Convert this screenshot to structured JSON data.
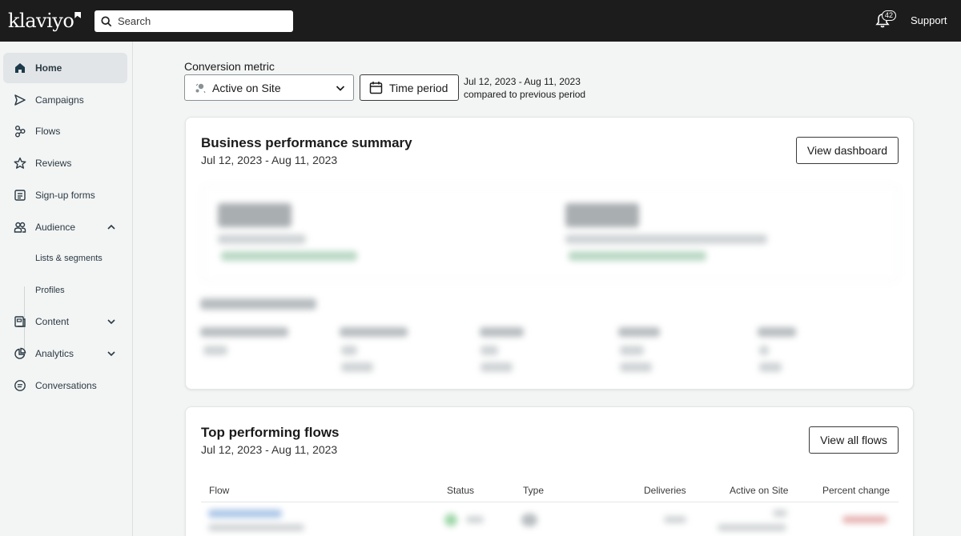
{
  "topbar": {
    "logo": "klaviyo",
    "search_placeholder": "Search",
    "notification_count": "42",
    "support_label": "Support"
  },
  "sidebar": {
    "items": [
      {
        "label": "Home",
        "icon": "home-icon",
        "active": true
      },
      {
        "label": "Campaigns",
        "icon": "send-icon"
      },
      {
        "label": "Flows",
        "icon": "flows-icon"
      },
      {
        "label": "Reviews",
        "icon": "star-icon"
      },
      {
        "label": "Sign-up forms",
        "icon": "form-icon"
      },
      {
        "label": "Audience",
        "icon": "users-icon",
        "expanded": true
      },
      {
        "label": "Content",
        "icon": "content-icon"
      },
      {
        "label": "Analytics",
        "icon": "analytics-icon"
      },
      {
        "label": "Conversations",
        "icon": "chat-icon"
      }
    ],
    "audience_sub": [
      "Lists & segments",
      "Profiles"
    ]
  },
  "filters": {
    "conversion_metric_label": "Conversion metric",
    "conversion_metric_value": "Active on Site",
    "time_period_label": "Time period",
    "date_range": "Jul 12, 2023 - Aug 11, 2023",
    "comparison": "compared to previous period"
  },
  "business_summary": {
    "title": "Business performance summary",
    "date_range": "Jul 12, 2023 - Aug 11, 2023",
    "button": "View dashboard"
  },
  "top_flows": {
    "title": "Top performing flows",
    "date_range": "Jul 12, 2023 - Aug 11, 2023",
    "button": "View all flows",
    "columns": [
      "Flow",
      "Status",
      "Type",
      "Deliveries",
      "Active on Site",
      "Percent change"
    ]
  },
  "colors": {
    "topbar": "#1c1c1c",
    "sidebar_bg": "#f3f4f4",
    "active_nav": "#e2e5e7"
  }
}
